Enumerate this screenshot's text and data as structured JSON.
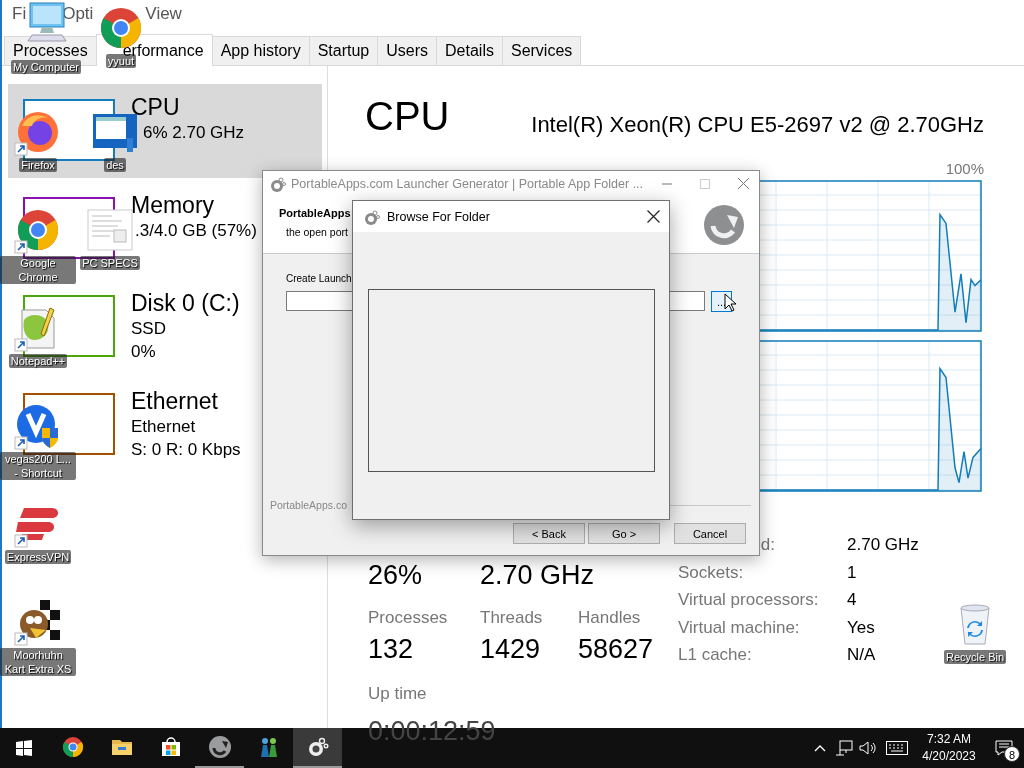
{
  "task_manager": {
    "menu": [
      "Fi",
      "Opti",
      "View"
    ],
    "tabs": [
      {
        "label": "Processes",
        "selected": false
      },
      {
        "label": "erformance",
        "selected": true
      },
      {
        "label": "App history",
        "selected": false
      },
      {
        "label": "Startup",
        "selected": false
      },
      {
        "label": "Users",
        "selected": false
      },
      {
        "label": "Details",
        "selected": false
      },
      {
        "label": "Services",
        "selected": false
      }
    ],
    "sidebar": [
      {
        "name": "CPU",
        "lines": [
          "6% 2.70 GHz"
        ],
        "color": "#117dbb",
        "selected": true
      },
      {
        "name": "Memory",
        "lines": [
          ".3/4.0 GB (57%)"
        ],
        "color": "#8b12ae",
        "selected": false
      },
      {
        "name": "Disk 0 (C:)",
        "lines": [
          "SSD",
          "0%"
        ],
        "color": "#4da60c",
        "selected": false
      },
      {
        "name": "Ethernet",
        "lines": [
          "Ethernet",
          "S: 0 R: 0 Kbps"
        ],
        "color": "#a74f01",
        "selected": false
      }
    ],
    "title": "CPU",
    "model": "Intel(R) Xeon(R) CPU E5-2697 v2 @ 2.70GHz",
    "graph_max": "100%",
    "top_values": [
      "26%",
      "2.70 GHz"
    ],
    "counters": [
      {
        "label": "Processes",
        "value": "132"
      },
      {
        "label": "Threads",
        "value": "1429"
      },
      {
        "label": "Handles",
        "value": "58627"
      }
    ],
    "uptime_label": "Up time",
    "uptime": "0:00:12:59",
    "details": [
      {
        "label": "d:",
        "value": "2.70 GHz"
      },
      {
        "label": "Sockets:",
        "value": "1"
      },
      {
        "label": "Virtual processors:",
        "value": "4"
      },
      {
        "label": "Virtual machine:",
        "value": "Yes"
      },
      {
        "label": "L1 cache:",
        "value": "N/A"
      }
    ]
  },
  "launcher_dialog": {
    "title": "PortableApps.com Launcher Generator | Portable App Folder ...",
    "heading": "PortableApps",
    "subheading": "the open port",
    "field_label": "Create Launch",
    "browse_button": "...",
    "footer": "PortableApps.co",
    "buttons": [
      "< Back",
      "Go >",
      "Cancel"
    ]
  },
  "browse_dialog": {
    "title": "Browse For Folder"
  },
  "desktop_icons": [
    {
      "label": "My Computer",
      "kind": "computer",
      "shortcut": false
    },
    {
      "label": "yyuut",
      "kind": "chrome",
      "shortcut": false
    },
    {
      "label": "Firefox",
      "kind": "firefox",
      "shortcut": true
    },
    {
      "label": "des",
      "kind": "screenshot",
      "shortcut": false
    },
    {
      "label": "Google Chrome",
      "kind": "chrome",
      "shortcut": true
    },
    {
      "label": "PC SPECS",
      "kind": "document",
      "shortcut": false
    },
    {
      "label": "Notepad++",
      "kind": "notepad",
      "shortcut": true
    },
    {
      "label": "vegas200 L... - Shortcut",
      "kind": "vegas",
      "shortcut": true
    },
    {
      "label": "ExpressVPN",
      "kind": "vpn",
      "shortcut": true
    },
    {
      "label": "Moorhuhn Kart Extra XS",
      "kind": "game",
      "shortcut": true
    },
    {
      "label": "Recycle Bin",
      "kind": "recycle",
      "shortcut": false
    }
  ],
  "taskbar": {
    "apps": [
      {
        "kind": "chrome",
        "running": false,
        "selected": false
      },
      {
        "kind": "folder",
        "running": false,
        "selected": false
      },
      {
        "kind": "store",
        "running": false,
        "selected": false
      },
      {
        "kind": "portableapps",
        "running": true,
        "selected": false
      },
      {
        "kind": "people",
        "running": false,
        "selected": false
      },
      {
        "kind": "launcher",
        "running": true,
        "selected": true
      }
    ],
    "time": "7:32 AM",
    "date": "4/20/2023",
    "notifications": "8"
  }
}
